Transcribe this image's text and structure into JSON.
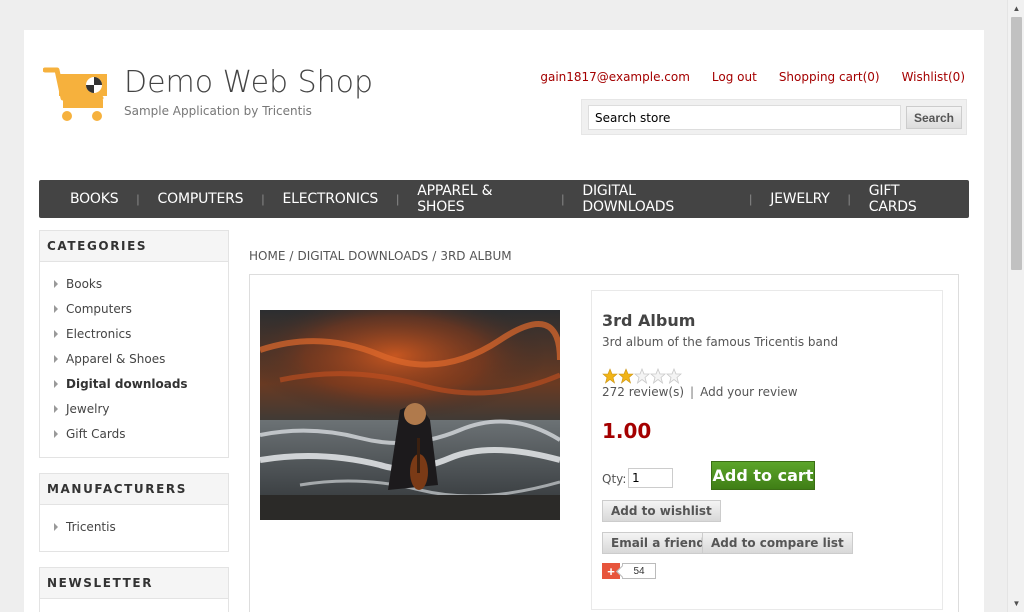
{
  "header": {
    "title": "Demo Web Shop",
    "subtitle": "Sample Application by Tricentis",
    "links": {
      "account": "gain1817@example.com",
      "logout": "Log out",
      "cart": "Shopping cart(0)",
      "wishlist": "Wishlist(0)"
    },
    "search": {
      "value": "Search store",
      "button": "Search"
    }
  },
  "top_menu": [
    "BOOKS",
    "COMPUTERS",
    "ELECTRONICS",
    "APPAREL & SHOES",
    "DIGITAL DOWNLOADS",
    "JEWELRY",
    "GIFT CARDS"
  ],
  "sidebar": {
    "categories_title": "CATEGORIES",
    "categories": [
      "Books",
      "Computers",
      "Electronics",
      "Apparel & Shoes",
      "Digital downloads",
      "Jewelry",
      "Gift Cards"
    ],
    "active_category": "Digital downloads",
    "manufacturers_title": "MANUFACTURERS",
    "manufacturers": [
      "Tricentis"
    ],
    "newsletter_title": "NEWSLETTER"
  },
  "breadcrumb": [
    "HOME",
    "DIGITAL DOWNLOADS",
    "3RD ALBUM"
  ],
  "product": {
    "name": "3rd Album",
    "short_description": "3rd album of the famous Tricentis band",
    "rating_stars": 2,
    "rating_max": 5,
    "reviews": "272 review(s)",
    "add_review": "Add your review",
    "price": "1.00",
    "qty_label": "Qty:",
    "qty_value": "1",
    "add_to_cart": "Add to cart",
    "add_to_wishlist": "Add to wishlist",
    "email_friend": "Email a friend",
    "add_to_compare": "Add to compare list",
    "share_count": "54"
  },
  "colors": {
    "accent_red": "#a40000",
    "menu_bg": "#444444",
    "cart_green": "#4c8f1f",
    "logo_orange": "#f6b13d"
  }
}
